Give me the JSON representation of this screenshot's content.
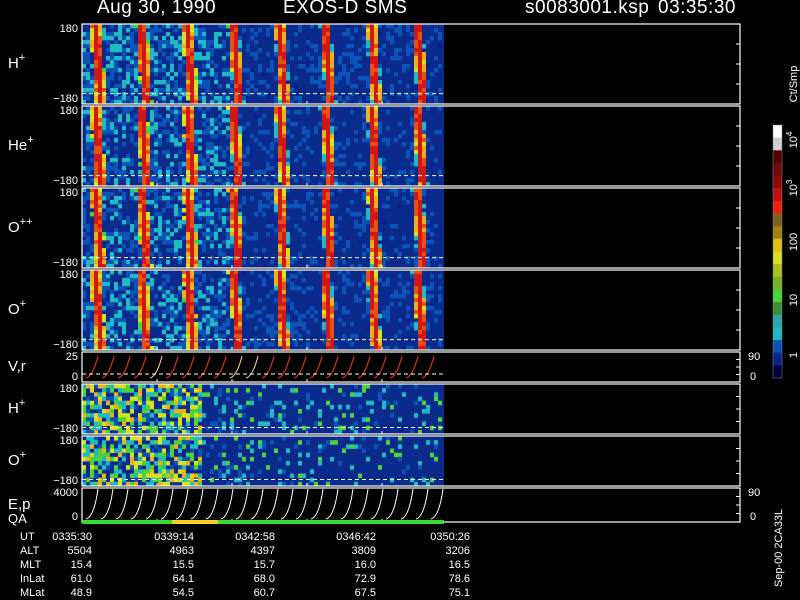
{
  "header": {
    "date": "Aug 30, 1990",
    "instrument": "EXOS-D SMS",
    "file": "s0083001.ksp",
    "time": "03:35:30"
  },
  "chart_data": {
    "type": "heatmap",
    "time_ticks": [
      "0335:30",
      "0339:14",
      "0342:58",
      "0346:42",
      "0350:26"
    ],
    "panels": [
      {
        "id": "h-plus",
        "label": "H",
        "sup": "+",
        "top_label": "180",
        "bottom_label": "−180"
      },
      {
        "id": "he-plus",
        "label": "He",
        "sup": "+",
        "top_label": "180",
        "bottom_label": "−180"
      },
      {
        "id": "o-plus-plus",
        "label": "O",
        "sup": "++",
        "top_label": "180",
        "bottom_label": "−180"
      },
      {
        "id": "o-plus",
        "label": "O",
        "sup": "+",
        "top_label": "180",
        "bottom_label": "−180"
      },
      {
        "id": "vr",
        "label": "V,r",
        "sup": "",
        "top_label": "25",
        "bottom_label": "0",
        "right_top": "90",
        "right_bottom": "0"
      },
      {
        "id": "h-plus-2",
        "label": "H",
        "sup": "+",
        "top_label": "180",
        "bottom_label": "−180"
      },
      {
        "id": "o-plus-2",
        "label": "O",
        "sup": "+",
        "top_label": "180",
        "bottom_label": "−180"
      },
      {
        "id": "ep",
        "label": "E,p",
        "sup": "",
        "top_label": "4000",
        "bottom_label": "0",
        "right_top": "90",
        "right_bottom": "0"
      }
    ],
    "qa_label": "QA",
    "qa_colors": [
      "#33dd33",
      "#f0d020",
      "#33dd33"
    ],
    "colorbar": {
      "unit": "Ct/Smp",
      "ticks": [
        {
          "base": "10",
          "exp": "4"
        },
        {
          "base": "10",
          "exp": "3"
        },
        {
          "base": "100",
          "exp": ""
        },
        {
          "base": "10",
          "exp": ""
        },
        {
          "base": "1",
          "exp": ""
        }
      ]
    },
    "ephemeris": {
      "rows": [
        {
          "label": "UT",
          "values": [
            "0335:30",
            "0339:14",
            "0342:58",
            "0346:42",
            "0350:26"
          ]
        },
        {
          "label": "ALT",
          "values": [
            "5504",
            "4963",
            "4397",
            "3809",
            "3206"
          ]
        },
        {
          "label": "MLT",
          "values": [
            "15.4",
            "15.5",
            "15.7",
            "16.0",
            "16.5"
          ]
        },
        {
          "label": "InLat",
          "values": [
            "61.0",
            "64.1",
            "68.0",
            "72.9",
            "78.6"
          ]
        },
        {
          "label": "MLat",
          "values": [
            "48.9",
            "54.5",
            "60.7",
            "67.5",
            "75.1"
          ]
        }
      ]
    },
    "footer_note": "Sep-00 2CA33L"
  }
}
